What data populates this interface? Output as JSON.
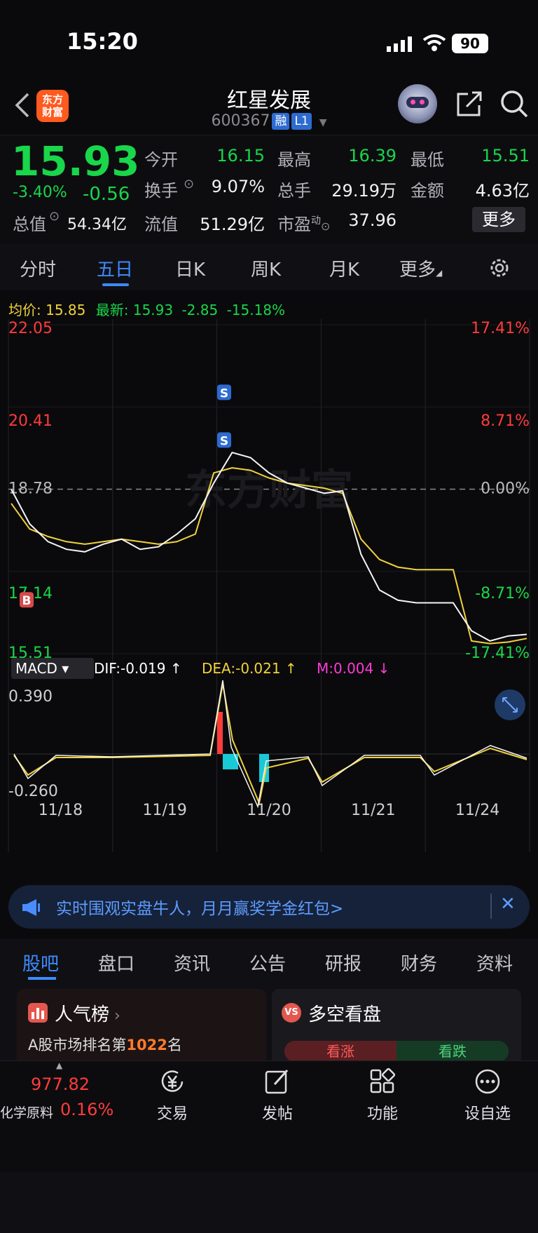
{
  "status_bar": {
    "time": "15:20",
    "battery": "90"
  },
  "header": {
    "logo_line1": "东方",
    "logo_line2": "财富",
    "stock_name": "红星发展",
    "stock_code": "600367",
    "tag_rong": "融",
    "tag_level": "L1"
  },
  "quote": {
    "price": "15.93",
    "change_pct": "-3.40%",
    "change": "-0.56",
    "open_label": "今开",
    "open": "16.15",
    "high_label": "最高",
    "high": "16.39",
    "low_label": "最低",
    "low": "15.51",
    "turnover_label": "换手",
    "turnover": "9.07%",
    "volume_label": "总手",
    "volume": "29.19万",
    "amount_label": "金额",
    "amount": "4.63亿",
    "mktcap_label": "总值",
    "mktcap": "54.34亿",
    "float_label": "流值",
    "float": "51.29亿",
    "pe_label": "市盈",
    "pe_sup": "动",
    "pe": "37.96",
    "more_label": "更多"
  },
  "tabs": [
    "分时",
    "五日",
    "日K",
    "周K",
    "月K",
    "更多"
  ],
  "active_tab": "五日",
  "avg_row": {
    "avg_label": "均价:",
    "avg": "15.85",
    "latest_label": "最新:",
    "latest": "15.93",
    "diff": "-2.85",
    "diff_pct": "-15.18%"
  },
  "chart_data": {
    "type": "line",
    "x_labels": [
      "11/18",
      "11/19",
      "11/20",
      "11/21",
      "11/24"
    ],
    "price_axis": [
      "22.05",
      "20.41",
      "18.78",
      "17.14",
      "15.51"
    ],
    "pct_axis": [
      "17.41%",
      "8.71%",
      "0.00%",
      "-8.71%",
      "-17.41%"
    ],
    "ylim": [
      15.51,
      22.05
    ],
    "prev_close": 18.78,
    "series": [
      {
        "name": "price",
        "values": [
          18.78,
          18.1,
          17.75,
          17.6,
          17.55,
          17.7,
          17.8,
          17.6,
          17.65,
          17.9,
          18.2,
          18.9,
          19.5,
          19.4,
          19.1,
          18.9,
          18.8,
          18.7,
          18.75,
          17.5,
          16.8,
          16.6,
          16.55,
          16.55,
          16.55,
          16.0,
          15.8,
          15.9,
          15.93
        ]
      },
      {
        "name": "avg",
        "values": [
          18.5,
          18.0,
          17.85,
          17.75,
          17.7,
          17.75,
          17.8,
          17.75,
          17.7,
          17.75,
          17.9,
          19.1,
          19.2,
          19.15,
          19.0,
          18.9,
          18.85,
          18.8,
          18.7,
          17.8,
          17.4,
          17.25,
          17.2,
          17.2,
          17.2,
          15.8,
          15.75,
          15.78,
          15.85
        ]
      }
    ],
    "markers": [
      {
        "label": "B"
      },
      {
        "label": "S"
      },
      {
        "label": "S"
      }
    ],
    "macd": {
      "name": "MACD",
      "dif_label": "DIF:",
      "dif": "-0.019",
      "dea_label": "DEA:",
      "dea": "-0.021",
      "m_label": "M:",
      "m": "0.004",
      "axis_top": "0.390",
      "axis_bottom": "-0.260"
    },
    "watermark": "东方财富"
  },
  "banner": {
    "text": "实时围观实盘牛人，月月赢奖学金红包>"
  },
  "section_tabs": [
    "股吧",
    "盘口",
    "资讯",
    "公告",
    "研报",
    "财务",
    "资料"
  ],
  "cards": {
    "left_title": "人气榜",
    "left_sub_prefix": "A股市场排名第",
    "left_rank": "1022",
    "left_sub_suffix": "名",
    "right_title": "多空看盘",
    "bull": "看涨",
    "bear": "看跌"
  },
  "bottom_nav": {
    "index_value": "977.82",
    "index_name": "化学原料",
    "index_pct": "0.16%",
    "trade": "交易",
    "post": "发帖",
    "func": "功能",
    "watch": "设自选"
  }
}
